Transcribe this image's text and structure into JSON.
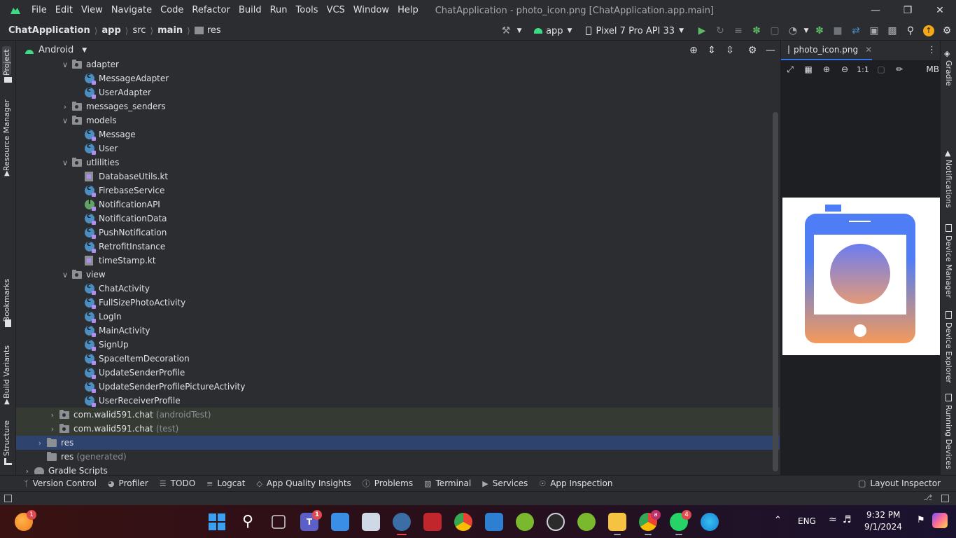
{
  "window": {
    "menu": [
      "File",
      "Edit",
      "View",
      "Navigate",
      "Code",
      "Refactor",
      "Build",
      "Run",
      "Tools",
      "VCS",
      "Window",
      "Help"
    ],
    "title": "ChatApplication - photo_icon.png [ChatApplication.app.main]",
    "controls": [
      "minimize-icon",
      "restore-icon",
      "close-icon"
    ]
  },
  "navbar": {
    "breadcrumb": [
      "ChatApplication",
      "app",
      "src",
      "main",
      "res"
    ],
    "run_config": "app",
    "device": "Pixel 7 Pro API 33"
  },
  "left_stripe": {
    "items": [
      "Project",
      "Resource Manager",
      "Bookmarks",
      "Build Variants",
      "Structure"
    ]
  },
  "project_panel": {
    "view_mode": "Android",
    "tree": [
      {
        "label": "adapter",
        "kind": "folder",
        "expanded": true
      },
      {
        "label": "MessageAdapter",
        "kind": "class"
      },
      {
        "label": "UserAdapter",
        "kind": "class"
      },
      {
        "label": "messages_senders",
        "kind": "folder",
        "expanded": false
      },
      {
        "label": "models",
        "kind": "folder",
        "expanded": true
      },
      {
        "label": "Message",
        "kind": "class"
      },
      {
        "label": "User",
        "kind": "class"
      },
      {
        "label": "utlilities",
        "kind": "folder",
        "expanded": true
      },
      {
        "label": "DatabaseUtils.kt",
        "kind": "kotlin-file"
      },
      {
        "label": "FirebaseService",
        "kind": "class"
      },
      {
        "label": "NotificationAPI",
        "kind": "interface"
      },
      {
        "label": "NotificationData",
        "kind": "class"
      },
      {
        "label": "PushNotification",
        "kind": "class"
      },
      {
        "label": "RetrofitInstance",
        "kind": "class"
      },
      {
        "label": "timeStamp.kt",
        "kind": "kotlin-file"
      },
      {
        "label": "view",
        "kind": "folder",
        "expanded": true
      },
      {
        "label": "ChatActivity",
        "kind": "class"
      },
      {
        "label": "FullSizePhotoActivity",
        "kind": "class"
      },
      {
        "label": "LogIn",
        "kind": "class"
      },
      {
        "label": "MainActivity",
        "kind": "class"
      },
      {
        "label": "SignUp",
        "kind": "class"
      },
      {
        "label": "SpaceItemDecoration",
        "kind": "class"
      },
      {
        "label": "UpdateSenderProfile",
        "kind": "class"
      },
      {
        "label": "UpdateSenderProfilePictureActivity",
        "kind": "class"
      },
      {
        "label": "UserReceiverProfile",
        "kind": "class"
      },
      {
        "label": "com.walid591.chat",
        "sub": "(androidTest)",
        "kind": "folder",
        "expanded": false
      },
      {
        "label": "com.walid591.chat",
        "sub": "(test)",
        "kind": "folder",
        "expanded": false
      },
      {
        "label": "res",
        "kind": "res-folder",
        "expanded": false,
        "selected": true
      },
      {
        "label": "res",
        "sub": "(generated)",
        "kind": "res-folder"
      },
      {
        "label": "Gradle Scripts",
        "kind": "gradle",
        "expanded": false
      }
    ]
  },
  "editor": {
    "tab": "photo_icon.png",
    "zoom_label": "1:1",
    "size_unit": "MB",
    "image": {
      "frame_color": "#4f7df5",
      "gradient_bottom": "#f59a5a",
      "circle_top": "#6b7cf2",
      "circle_bottom": "#e39a78"
    }
  },
  "right_stripe": {
    "items": [
      "Gradle",
      "Notifications",
      "Device Manager",
      "Device Explorer",
      "Running Devices"
    ]
  },
  "bottom_tools": [
    {
      "label": "Version Control",
      "icon": "branch-icon"
    },
    {
      "label": "Profiler",
      "icon": "gauge-icon"
    },
    {
      "label": "TODO",
      "icon": "list-icon"
    },
    {
      "label": "Logcat",
      "icon": "logcat-icon"
    },
    {
      "label": "App Quality Insights",
      "icon": "diamond-icon"
    },
    {
      "label": "Problems",
      "icon": "info-icon"
    },
    {
      "label": "Terminal",
      "icon": "terminal-icon"
    },
    {
      "label": "Services",
      "icon": "services-icon"
    },
    {
      "label": "App Inspection",
      "icon": "inspection-icon"
    }
  ],
  "bottom_right_tool": "Layout Inspector",
  "taskbar": {
    "badges": {
      "first": "1",
      "teams": "1",
      "chrome_profile": "a",
      "whatsapp": "4"
    },
    "language": "ENG",
    "time": "9:32 PM",
    "date": "9/1/2024"
  }
}
